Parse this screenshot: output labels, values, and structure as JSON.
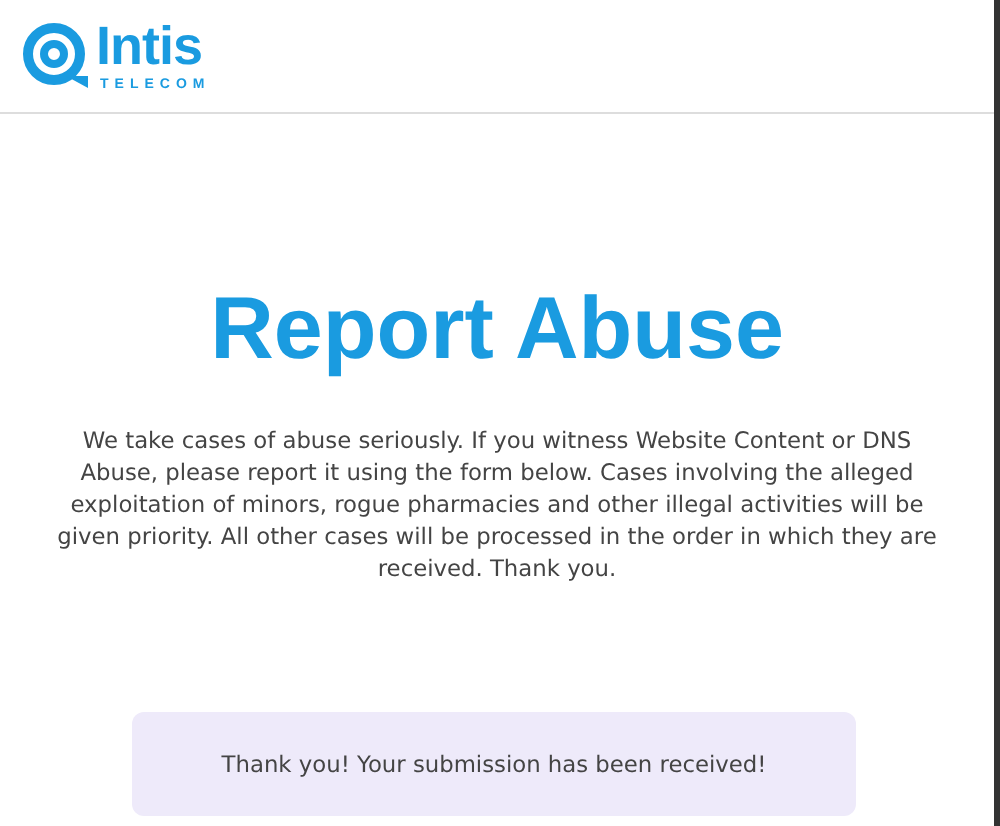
{
  "header": {
    "logo": {
      "name": "Intis",
      "tagline": "TELECOM"
    }
  },
  "title": "Report Abuse",
  "intro": "We take cases of abuse seriously. If you witness Website Content or DNS Abuse, please report it using the form below. Cases involving the alleged exploitation of minors, rogue pharmacies and other illegal activities will be given priority. All other cases will be processed in the order in which they are received. Thank you.",
  "success_message": "Thank you! Your submission has been received!"
}
